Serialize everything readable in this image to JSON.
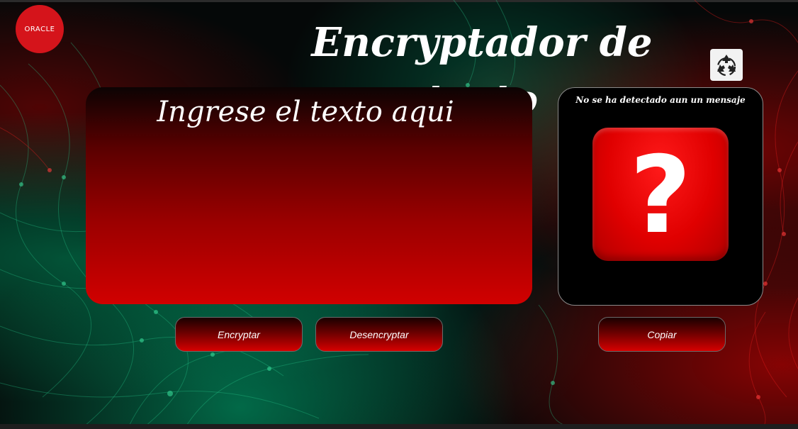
{
  "header": {
    "logo_text": "ORACLE",
    "title": "Encryptador de texto"
  },
  "icons": {
    "clear": "recycle-icon"
  },
  "input": {
    "placeholder": "Ingrese el texto aqui"
  },
  "output": {
    "message": "No se ha detectado aun un mensaje",
    "icon": "question-mark-icon",
    "glyph": "?"
  },
  "buttons": {
    "encrypt_label": "Encryptar",
    "decrypt_label": "Desencryptar",
    "copy_label": "Copiar"
  },
  "colors": {
    "brand_red": "#d5141b",
    "accent_red": "#d10000",
    "panel_black": "#000000"
  }
}
